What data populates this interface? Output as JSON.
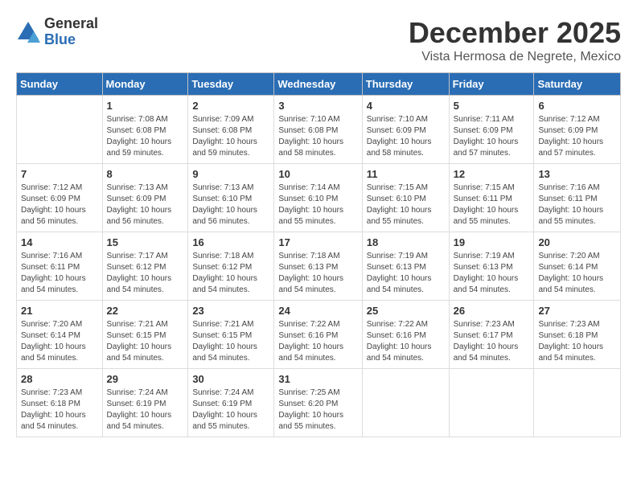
{
  "logo": {
    "general": "General",
    "blue": "Blue"
  },
  "title": "December 2025",
  "subtitle": "Vista Hermosa de Negrete, Mexico",
  "days_of_week": [
    "Sunday",
    "Monday",
    "Tuesday",
    "Wednesday",
    "Thursday",
    "Friday",
    "Saturday"
  ],
  "weeks": [
    [
      {
        "day": "",
        "info": ""
      },
      {
        "day": "1",
        "info": "Sunrise: 7:08 AM\nSunset: 6:08 PM\nDaylight: 10 hours\nand 59 minutes."
      },
      {
        "day": "2",
        "info": "Sunrise: 7:09 AM\nSunset: 6:08 PM\nDaylight: 10 hours\nand 59 minutes."
      },
      {
        "day": "3",
        "info": "Sunrise: 7:10 AM\nSunset: 6:08 PM\nDaylight: 10 hours\nand 58 minutes."
      },
      {
        "day": "4",
        "info": "Sunrise: 7:10 AM\nSunset: 6:09 PM\nDaylight: 10 hours\nand 58 minutes."
      },
      {
        "day": "5",
        "info": "Sunrise: 7:11 AM\nSunset: 6:09 PM\nDaylight: 10 hours\nand 57 minutes."
      },
      {
        "day": "6",
        "info": "Sunrise: 7:12 AM\nSunset: 6:09 PM\nDaylight: 10 hours\nand 57 minutes."
      }
    ],
    [
      {
        "day": "7",
        "info": "Sunrise: 7:12 AM\nSunset: 6:09 PM\nDaylight: 10 hours\nand 56 minutes."
      },
      {
        "day": "8",
        "info": "Sunrise: 7:13 AM\nSunset: 6:09 PM\nDaylight: 10 hours\nand 56 minutes."
      },
      {
        "day": "9",
        "info": "Sunrise: 7:13 AM\nSunset: 6:10 PM\nDaylight: 10 hours\nand 56 minutes."
      },
      {
        "day": "10",
        "info": "Sunrise: 7:14 AM\nSunset: 6:10 PM\nDaylight: 10 hours\nand 55 minutes."
      },
      {
        "day": "11",
        "info": "Sunrise: 7:15 AM\nSunset: 6:10 PM\nDaylight: 10 hours\nand 55 minutes."
      },
      {
        "day": "12",
        "info": "Sunrise: 7:15 AM\nSunset: 6:11 PM\nDaylight: 10 hours\nand 55 minutes."
      },
      {
        "day": "13",
        "info": "Sunrise: 7:16 AM\nSunset: 6:11 PM\nDaylight: 10 hours\nand 55 minutes."
      }
    ],
    [
      {
        "day": "14",
        "info": "Sunrise: 7:16 AM\nSunset: 6:11 PM\nDaylight: 10 hours\nand 54 minutes."
      },
      {
        "day": "15",
        "info": "Sunrise: 7:17 AM\nSunset: 6:12 PM\nDaylight: 10 hours\nand 54 minutes."
      },
      {
        "day": "16",
        "info": "Sunrise: 7:18 AM\nSunset: 6:12 PM\nDaylight: 10 hours\nand 54 minutes."
      },
      {
        "day": "17",
        "info": "Sunrise: 7:18 AM\nSunset: 6:13 PM\nDaylight: 10 hours\nand 54 minutes."
      },
      {
        "day": "18",
        "info": "Sunrise: 7:19 AM\nSunset: 6:13 PM\nDaylight: 10 hours\nand 54 minutes."
      },
      {
        "day": "19",
        "info": "Sunrise: 7:19 AM\nSunset: 6:13 PM\nDaylight: 10 hours\nand 54 minutes."
      },
      {
        "day": "20",
        "info": "Sunrise: 7:20 AM\nSunset: 6:14 PM\nDaylight: 10 hours\nand 54 minutes."
      }
    ],
    [
      {
        "day": "21",
        "info": "Sunrise: 7:20 AM\nSunset: 6:14 PM\nDaylight: 10 hours\nand 54 minutes."
      },
      {
        "day": "22",
        "info": "Sunrise: 7:21 AM\nSunset: 6:15 PM\nDaylight: 10 hours\nand 54 minutes."
      },
      {
        "day": "23",
        "info": "Sunrise: 7:21 AM\nSunset: 6:15 PM\nDaylight: 10 hours\nand 54 minutes."
      },
      {
        "day": "24",
        "info": "Sunrise: 7:22 AM\nSunset: 6:16 PM\nDaylight: 10 hours\nand 54 minutes."
      },
      {
        "day": "25",
        "info": "Sunrise: 7:22 AM\nSunset: 6:16 PM\nDaylight: 10 hours\nand 54 minutes."
      },
      {
        "day": "26",
        "info": "Sunrise: 7:23 AM\nSunset: 6:17 PM\nDaylight: 10 hours\nand 54 minutes."
      },
      {
        "day": "27",
        "info": "Sunrise: 7:23 AM\nSunset: 6:18 PM\nDaylight: 10 hours\nand 54 minutes."
      }
    ],
    [
      {
        "day": "28",
        "info": "Sunrise: 7:23 AM\nSunset: 6:18 PM\nDaylight: 10 hours\nand 54 minutes."
      },
      {
        "day": "29",
        "info": "Sunrise: 7:24 AM\nSunset: 6:19 PM\nDaylight: 10 hours\nand 54 minutes."
      },
      {
        "day": "30",
        "info": "Sunrise: 7:24 AM\nSunset: 6:19 PM\nDaylight: 10 hours\nand 55 minutes."
      },
      {
        "day": "31",
        "info": "Sunrise: 7:25 AM\nSunset: 6:20 PM\nDaylight: 10 hours\nand 55 minutes."
      },
      {
        "day": "",
        "info": ""
      },
      {
        "day": "",
        "info": ""
      },
      {
        "day": "",
        "info": ""
      }
    ]
  ]
}
